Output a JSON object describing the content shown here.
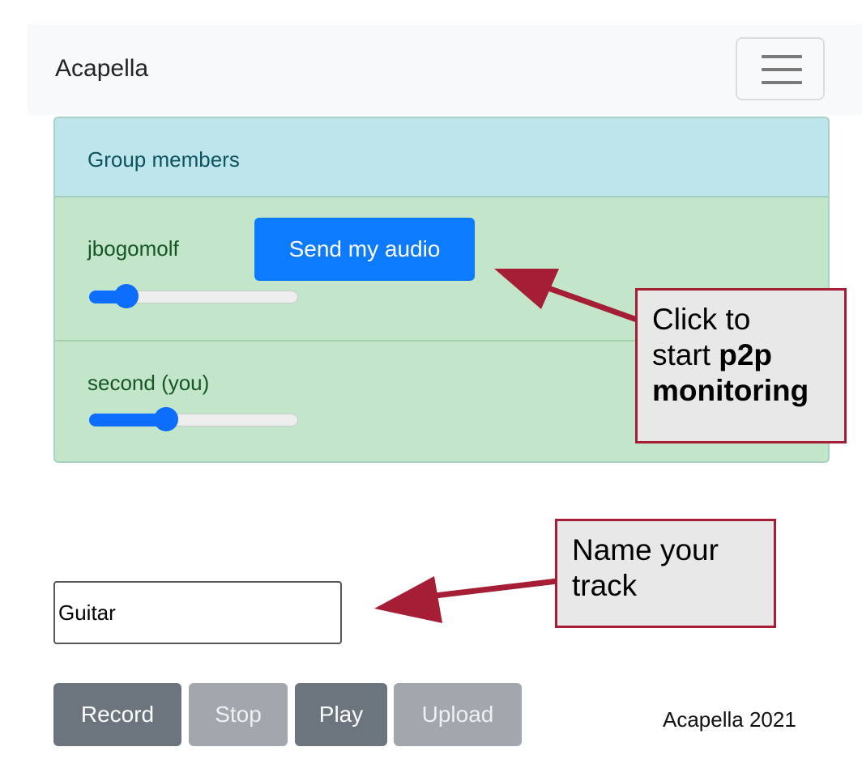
{
  "navbar": {
    "brand": "Acapella",
    "toggler_icon": "hamburger-menu-icon"
  },
  "group_card": {
    "header": "Group members",
    "members": [
      {
        "name": "jbogomolf",
        "volume": 0.18,
        "button_label": "Send my audio"
      },
      {
        "name": "second (you)",
        "volume": 0.37
      }
    ]
  },
  "track_input": {
    "value": "Guitar"
  },
  "controls": {
    "record": "Record",
    "stop": "Stop",
    "play": "Play",
    "upload": "Upload"
  },
  "footer": "Acapella 2021",
  "annotations": {
    "send_audio": {
      "line1": "Click to",
      "line2_pre": "start ",
      "line2_bold": "p2p",
      "line3_bold": "monitoring"
    },
    "track_name": {
      "line1": "Name your",
      "line2": "track"
    },
    "color": "#a61e36"
  }
}
